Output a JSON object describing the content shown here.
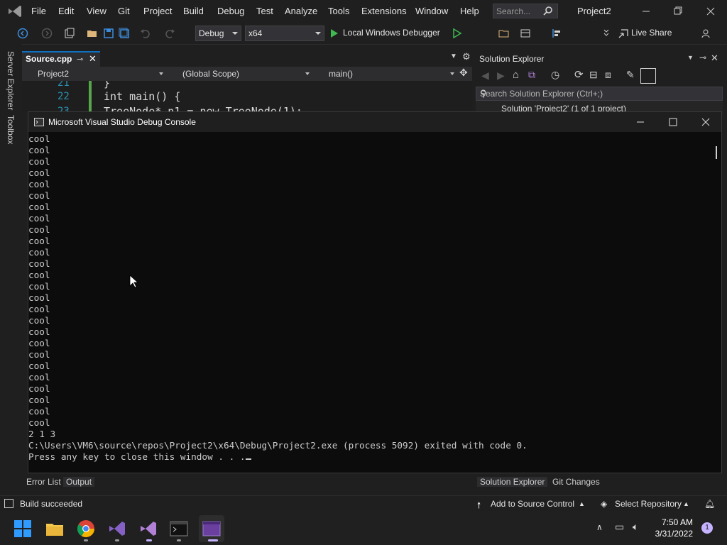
{
  "menu": [
    "File",
    "Edit",
    "View",
    "Git",
    "Project",
    "Build",
    "Debug",
    "Test",
    "Analyze",
    "Tools",
    "Extensions",
    "Window",
    "Help"
  ],
  "search": {
    "placeholder": "Search..."
  },
  "project_title": "Project2",
  "toolbar": {
    "config": "Debug",
    "platform": "x64",
    "debugger": "Local Windows Debugger",
    "live_share": "Live Share"
  },
  "left_strip": {
    "server_explorer": "Server Explorer",
    "toolbox": "Toolbox"
  },
  "editor": {
    "tab": "Source.cpp",
    "nav": {
      "project": "Project2",
      "scope": "(Global Scope)",
      "member": "main()"
    },
    "lines": [
      {
        "no": "21",
        "text": "}"
      },
      {
        "no": "22",
        "text": "int main() {"
      },
      {
        "no": "23",
        "text": "    TreeNode* n1 = new TreeNode(1);"
      }
    ]
  },
  "solution_explorer": {
    "title": "Solution Explorer",
    "search_placeholder": "Search Solution Explorer (Ctrl+;)",
    "root": "Solution 'Project2' (1 of 1 project)"
  },
  "console": {
    "title": "Microsoft Visual Studio Debug Console",
    "lines": [
      "cool",
      "cool",
      "cool",
      "cool",
      "cool",
      "cool",
      "cool",
      "cool",
      "cool",
      "cool",
      "cool",
      "cool",
      "cool",
      "cool",
      "cool",
      "cool",
      "cool",
      "cool",
      "cool",
      "cool",
      "cool",
      "cool",
      "cool",
      "cool",
      "cool",
      "cool",
      "2 1 3",
      "C:\\Users\\VM6\\source\\repos\\Project2\\x64\\Debug\\Project2.exe (process 5092) exited with code 0.",
      "Press any key to close this window . . ."
    ]
  },
  "bottom_tabs": {
    "error_list": "Error List",
    "output": "Output",
    "solution_explorer": "Solution Explorer",
    "git_changes": "Git Changes"
  },
  "status": {
    "build": "Build succeeded",
    "source_control": "Add to Source Control",
    "repo": "Select Repository"
  },
  "taskbar": {
    "time": "7:50 AM",
    "date": "3/31/2022",
    "notifications": "1"
  }
}
